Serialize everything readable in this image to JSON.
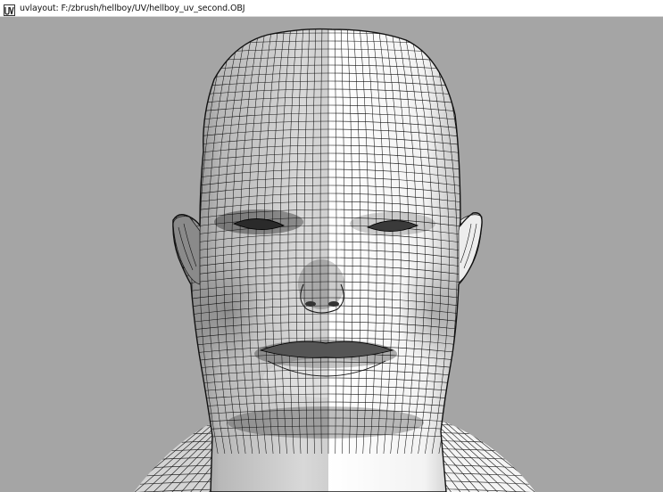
{
  "window": {
    "title": "uvlayout: F:/zbrush/hellboy/UV/hellboy_uv_second.OBJ",
    "app_icon": "uvlayout-app-icon"
  },
  "viewport": {
    "background_color": "#a5a5a5",
    "mesh_fill_color": "#f2f2f2",
    "mesh_shadow_color": "#7a7a7a",
    "wire_color": "#111111",
    "content": "wireframe-head-model"
  }
}
